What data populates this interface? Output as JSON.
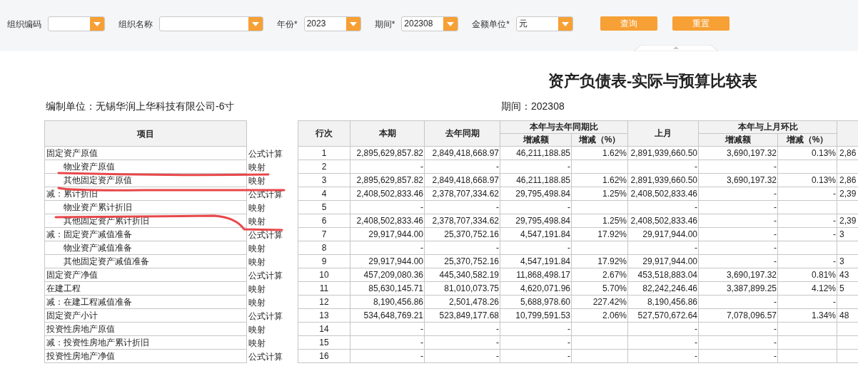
{
  "filters": [
    {
      "label": "组织编码",
      "kind": "select"
    },
    {
      "label": "组织名称",
      "kind": "select"
    },
    {
      "label": "年份*",
      "kind": "select",
      "value": "2023"
    },
    {
      "label": "期间*",
      "kind": "select",
      "value": "202308"
    },
    {
      "label": "金额单位*",
      "kind": "select",
      "value": "元"
    }
  ],
  "buttons": [
    "查询",
    "重置"
  ],
  "title": "资产负债表-实际与预算比较表",
  "org_line": "编制单位：无锡华润上华科技有限公司-6寸",
  "period_line": "期间：202308",
  "table": {
    "item_header": "项目",
    "header_rows": [
      [
        {
          "label": "行次",
          "rowspan": 2
        },
        {
          "label": "本期",
          "rowspan": 2
        },
        {
          "label": "去年同期",
          "rowspan": 2
        },
        {
          "label": "本年与去年同期比",
          "colspan": 2
        },
        {
          "label": "上月",
          "rowspan": 2
        },
        {
          "label": "本年与上月环比",
          "colspan": 2
        }
      ],
      [
        {
          "label": "增减额"
        },
        {
          "label": "增减（%）"
        },
        {
          "label": "增减额"
        },
        {
          "label": "增减（%）"
        }
      ]
    ],
    "rows": [
      {
        "item": "固定资产原值",
        "method": "公式计算",
        "cells": [
          "1",
          "2,895,629,857.82",
          "2,849,418,668.97",
          "46,211,188.85",
          "1.62%",
          "2,891,939,660.50",
          "3,690,197.32",
          "0.13%",
          "2,86"
        ],
        "children": [
          {
            "item": "物业资产原值",
            "method": "映射",
            "cells": [
              "2",
              "-",
              "-",
              "-",
              null,
              "-",
              "-",
              null,
              null
            ]
          },
          {
            "item": "其他固定资产原值",
            "method": "映射",
            "cells": [
              "3",
              "2,895,629,857.82",
              "2,849,418,668.97",
              "46,211,188.85",
              "1.62%",
              "2,891,939,660.50",
              "3,690,197.32",
              "0.13%",
              "2,86"
            ]
          }
        ]
      },
      {
        "item": "减：累计折旧",
        "method": "公式计算",
        "cells": [
          "4",
          "2,408,502,833.46",
          "2,378,707,334.62",
          "29,795,498.84",
          "1.25%",
          "2,408,502,833.46",
          "-",
          "-",
          "2,39"
        ],
        "children": [
          {
            "item": "物业资产累计折旧",
            "method": "映射",
            "cells": [
              "5",
              "-",
              "-",
              "-",
              null,
              "-",
              "-",
              null,
              null
            ]
          },
          {
            "item": "其他固定资产累计折旧",
            "method": "映射",
            "cells": [
              "6",
              "2,408,502,833.46",
              "2,378,707,334.62",
              "29,795,498.84",
              "1.25%",
              "2,408,502,833.46",
              "-",
              "-",
              "2,39"
            ]
          }
        ]
      },
      {
        "item": "减：固定资产减值准备",
        "method": "公式计算",
        "cells": [
          "7",
          "29,917,944.00",
          "25,370,752.16",
          "4,547,191.84",
          "17.92%",
          "29,917,944.00",
          "-",
          "-",
          "3"
        ],
        "children": [
          {
            "item": "物业资产减值准备",
            "method": "映射",
            "cells": [
              "8",
              "-",
              "-",
              "-",
              null,
              "-",
              "-",
              null,
              null
            ]
          },
          {
            "item": "其他固定资产减值准备",
            "method": "映射",
            "cells": [
              "9",
              "29,917,944.00",
              "25,370,752.16",
              "4,547,191.84",
              "17.92%",
              "29,917,944.00",
              "-",
              "-",
              "3"
            ]
          }
        ]
      },
      {
        "item": "固定资产净值",
        "method": "公式计算",
        "cells": [
          "10",
          "457,209,080.36",
          "445,340,582.19",
          "11,868,498.17",
          "2.67%",
          "453,518,883.04",
          "3,690,197.32",
          "0.81%",
          "43"
        ]
      },
      {
        "item": "在建工程",
        "method": "映射",
        "cells": [
          "11",
          "85,630,145.71",
          "81,010,073.75",
          "4,620,071.96",
          "5.70%",
          "82,242,246.46",
          "3,387,899.25",
          "4.12%",
          "5"
        ]
      },
      {
        "item": "减：在建工程减值准备",
        "method": "映射",
        "cells": [
          "12",
          "8,190,456.86",
          "2,501,478.26",
          "5,688,978.60",
          "227.42%",
          "8,190,456.86",
          "-",
          "-",
          null
        ]
      },
      {
        "item": "固定资产小计",
        "method": "公式计算",
        "cells": [
          "13",
          "534,648,769.21",
          "523,849,177.68",
          "10,799,591.53",
          "2.06%",
          "527,570,672.64",
          "7,078,096.57",
          "1.34%",
          "48"
        ]
      },
      {
        "item": "投资性房地产原值",
        "method": "映射",
        "cells": [
          "14",
          "-",
          "-",
          "-",
          null,
          "-",
          "-",
          null,
          null
        ]
      },
      {
        "item": "减：投资性房地产累计折旧",
        "method": "映射",
        "cells": [
          "15",
          "-",
          "-",
          "-",
          null,
          "-",
          "-",
          null,
          null
        ]
      },
      {
        "item": "投资性房地产净值",
        "method": "公式计算",
        "cells": [
          "16",
          "-",
          "-",
          "-",
          null,
          "-",
          "-",
          null,
          null
        ]
      }
    ]
  }
}
